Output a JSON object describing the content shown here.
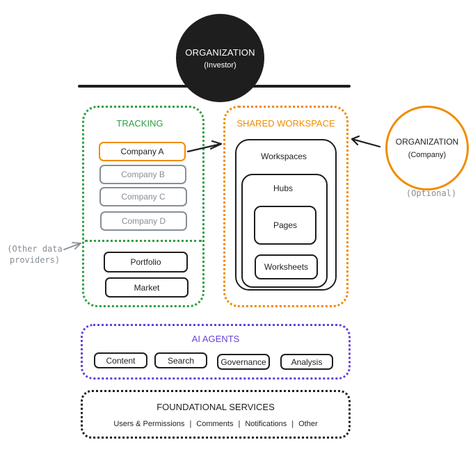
{
  "colors": {
    "ink": "#1e1e1e",
    "tracking": "#2f9e44",
    "shared_workspace": "#f08c00",
    "ai_agents": "#6741d9",
    "muted": "#868e96"
  },
  "organization_investor": {
    "title": "ORGANIZATION",
    "subtitle": "(Investor)"
  },
  "tracking": {
    "title": "TRACKING",
    "companies": [
      {
        "label": "Company A",
        "highlighted": true
      },
      {
        "label": "Company B",
        "highlighted": false
      },
      {
        "label": "Company C",
        "highlighted": false
      },
      {
        "label": "Company D",
        "highlighted": false
      }
    ],
    "data_items": [
      "Portfolio",
      "Market"
    ]
  },
  "other_data_providers": {
    "line1": "(Other data",
    "line2": "providers)"
  },
  "shared_workspace": {
    "title": "SHARED WORKSPACE",
    "workspaces": "Workspaces",
    "hubs": "Hubs",
    "pages": "Pages",
    "worksheets": "Worksheets"
  },
  "organization_company": {
    "title": "ORGANIZATION",
    "subtitle": "(Company)",
    "note": "(Optional)"
  },
  "ai_agents": {
    "title": "AI AGENTS",
    "items": [
      "Content",
      "Search",
      "Governance",
      "Analysis"
    ]
  },
  "foundational_services": {
    "title": "FOUNDATIONAL SERVICES",
    "items": [
      "Users & Permissions",
      "Comments",
      "Notifications",
      "Other"
    ],
    "separator": "|"
  }
}
